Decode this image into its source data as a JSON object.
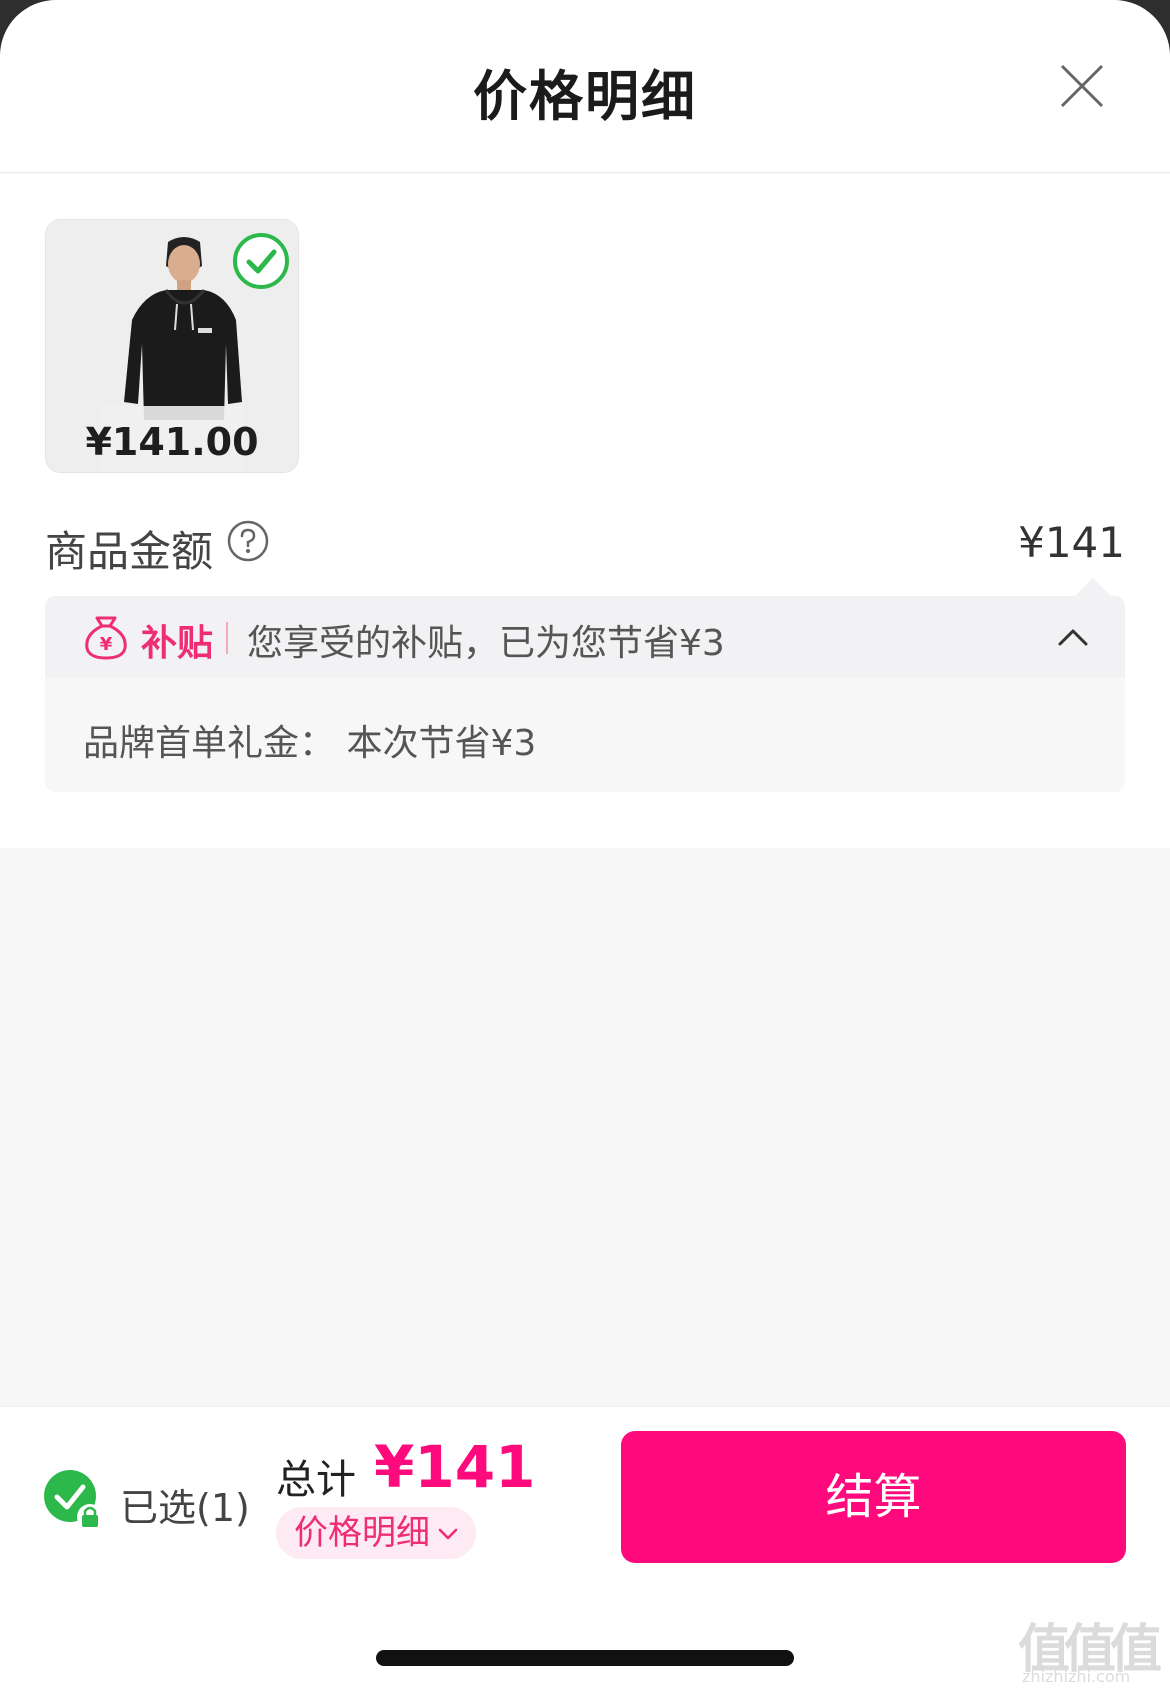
{
  "header": {
    "title": "价格明细",
    "close_icon": "close-icon"
  },
  "product": {
    "price": "¥141.00",
    "selected_icon": "check-circle-icon"
  },
  "amount": {
    "label": "商品金额",
    "value": "¥141",
    "help_icon": "question-circle-icon"
  },
  "subsidy": {
    "tag": "补贴",
    "description": "您享受的补贴，已为您节省¥3",
    "detail": "品牌首单礼金： 本次节省¥3",
    "icon": "money-bag-icon",
    "expanded": true
  },
  "footer": {
    "selected_text": "已选(1)",
    "total_label": "总计",
    "total_value": "¥141",
    "detail_link": "价格明细",
    "pay_button": "结算"
  },
  "watermark": {
    "chars": "值值值",
    "url": "zhizhizhi.com"
  },
  "colors": {
    "accent": "#ff0a7c",
    "accent_text": "#ee2d72",
    "check_green": "#2db84c"
  }
}
